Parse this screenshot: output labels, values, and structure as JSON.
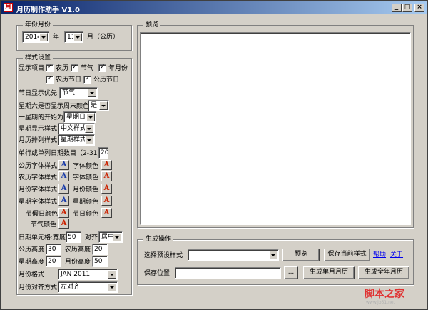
{
  "window": {
    "title": "月历制作助手 V1.0",
    "minimize": "_",
    "restore": "□",
    "close": "×"
  },
  "year_month": {
    "legend": "年份月份",
    "year_value": "2014",
    "year_label": "年",
    "month_value": "11",
    "month_label": "月（公历）"
  },
  "style": {
    "legend": "样式设置",
    "show_items_label": "显示项目",
    "show_items": [
      {
        "label": "农历",
        "checked": true
      },
      {
        "label": "节气",
        "checked": true
      },
      {
        "label": "年月份",
        "checked": true
      },
      {
        "label": "农历节日",
        "checked": true
      },
      {
        "label": "公历节日",
        "checked": true
      }
    ],
    "holiday_priority_label": "节日显示优先",
    "holiday_priority_value": "节气",
    "weekend_color_label": "星期六是否显示周末颜色",
    "weekend_color_value": "是",
    "week_start_label": "一星期的开始为",
    "week_start_value": "星期日",
    "week_display_label": "星期显示样式",
    "week_display_value": "中文样式",
    "arrange_label": "月历排列样式",
    "arrange_value": "星期样式",
    "single_row_label": "单行或单列日期数目（2-31）",
    "single_row_value": "20",
    "font_rows": [
      {
        "left": "公历字体样式",
        "right": "字体颜色"
      },
      {
        "left": "农历字体样式",
        "right": "字体颜色"
      },
      {
        "left": "月份字体样式",
        "right": "月份颜色"
      },
      {
        "left": "星期字体样式",
        "right": "星期颜色"
      },
      {
        "left": "节假日颜色",
        "right": "节日颜色"
      }
    ],
    "solar_term_color_label": "节气颜色",
    "font_glyph": "A",
    "cell_width_label": "日期单元格:宽度",
    "cell_width_value": "50",
    "align_label": "对齐",
    "align_value": "居中",
    "solar_height_label": "公历高度",
    "solar_height_value": "30",
    "lunar_height_label": "农历高度",
    "lunar_height_value": "20",
    "week_height_label": "星期高度",
    "week_height_value": "20",
    "month_height_label": "月份高度",
    "month_height_value": "50",
    "month_format_label": "月份格式",
    "month_format_value": "JAN 2011",
    "month_align_label": "月份对齐方式",
    "month_align_value": "左对齐"
  },
  "preview": {
    "legend": "预览"
  },
  "generate": {
    "legend": "生成操作",
    "preset_label": "选择预设样式",
    "preset_value": "",
    "preview_button": "预览",
    "save_style_button": "保存当前样式",
    "help_link": "帮助",
    "about_link": "关于",
    "save_location_label": "保存位置",
    "save_location_value": "",
    "browse_button": "...",
    "single_month_button": "生成单月月历",
    "full_year_button": "生成全年月历"
  },
  "watermark": {
    "text": "脚本之家",
    "url": "www.jb51.net"
  },
  "colors": {
    "font_blue": "#1a3caa",
    "font_red": "#cc2200",
    "titlebar_start": "#0a246a",
    "titlebar_end": "#a6caf0"
  }
}
